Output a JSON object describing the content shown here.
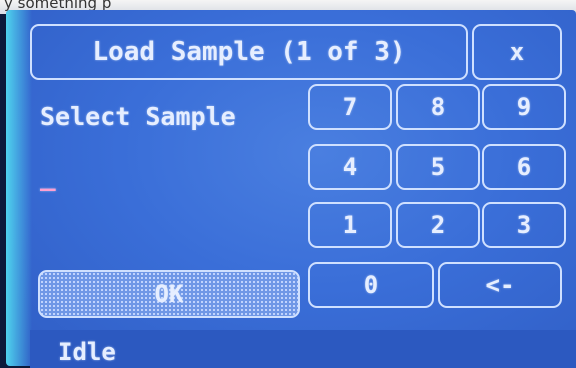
{
  "dialog": {
    "title": "Load Sample (1 of 3)",
    "close_label": "x",
    "prompt": "Select Sample",
    "entry_value": "_"
  },
  "keypad": {
    "keys": [
      "7",
      "8",
      "9",
      "4",
      "5",
      "6",
      "1",
      "2",
      "3"
    ],
    "zero": "0",
    "backspace": "<-",
    "ok": "OK"
  },
  "status": {
    "text": "Idle"
  },
  "colors": {
    "screen_bg": "#3a6ed8",
    "border": "#cfe0ff",
    "text": "#e6eeff",
    "cursor": "#ff9fd0"
  },
  "photo_edge": {
    "text": "y something p"
  }
}
